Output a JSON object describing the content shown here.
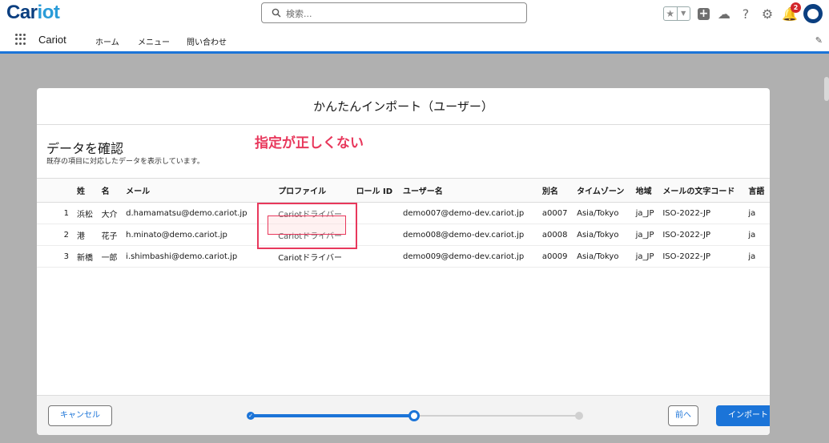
{
  "app": {
    "logo_main": "Car",
    "logo_accent": "iot",
    "name": "Cariot"
  },
  "search": {
    "placeholder": "検索..."
  },
  "header": {
    "notification_count": "2"
  },
  "nav": {
    "items": [
      "ホーム",
      "メニュー",
      "問い合わせ"
    ]
  },
  "modal": {
    "title": "かんたんインポート（ユーザー）",
    "section_title": "データを確認",
    "section_description": "既存の項目に対応したデータを表示しています。",
    "annotation": "指定が正しくない",
    "columns": [
      "",
      "姓",
      "名",
      "メール",
      "プロファイル",
      "ロール ID",
      "ユーザー名",
      "別名",
      "タイムゾーン",
      "地域",
      "メールの文字コード",
      "言語"
    ],
    "rows": [
      [
        "1",
        "浜松",
        "大介",
        "d.hamamatsu@demo.cariot.jp",
        "Cariotドライバー",
        "",
        "demo007@demo-dev.cariot.jp",
        "a0007",
        "Asia/Tokyo",
        "ja_JP",
        "ISO-2022-JP",
        "ja"
      ],
      [
        "2",
        "港",
        "花子",
        "h.minato@demo.cariot.jp",
        "Cariotドライバー",
        "",
        "demo008@demo-dev.cariot.jp",
        "a0008",
        "Asia/Tokyo",
        "ja_JP",
        "ISO-2022-JP",
        "ja"
      ],
      [
        "3",
        "新橋",
        "一郎",
        "i.shimbashi@demo.cariot.jp",
        "Cariotドライバー",
        "",
        "demo009@demo-dev.cariot.jp",
        "a0009",
        "Asia/Tokyo",
        "ja_JP",
        "ISO-2022-JP",
        "ja"
      ]
    ],
    "footer": {
      "cancel_label": "キャンセル",
      "prev_label": "前へ",
      "import_label": "インポート"
    },
    "progress": {
      "steps": [
        "complete",
        "current",
        "incomplete"
      ],
      "current_step": 2,
      "total_steps": 3
    }
  },
  "colors": {
    "accent": "#1b74d8",
    "annotation": "#e8385c",
    "logo": "#0b3f80",
    "overlay": "#b0b0b0"
  }
}
